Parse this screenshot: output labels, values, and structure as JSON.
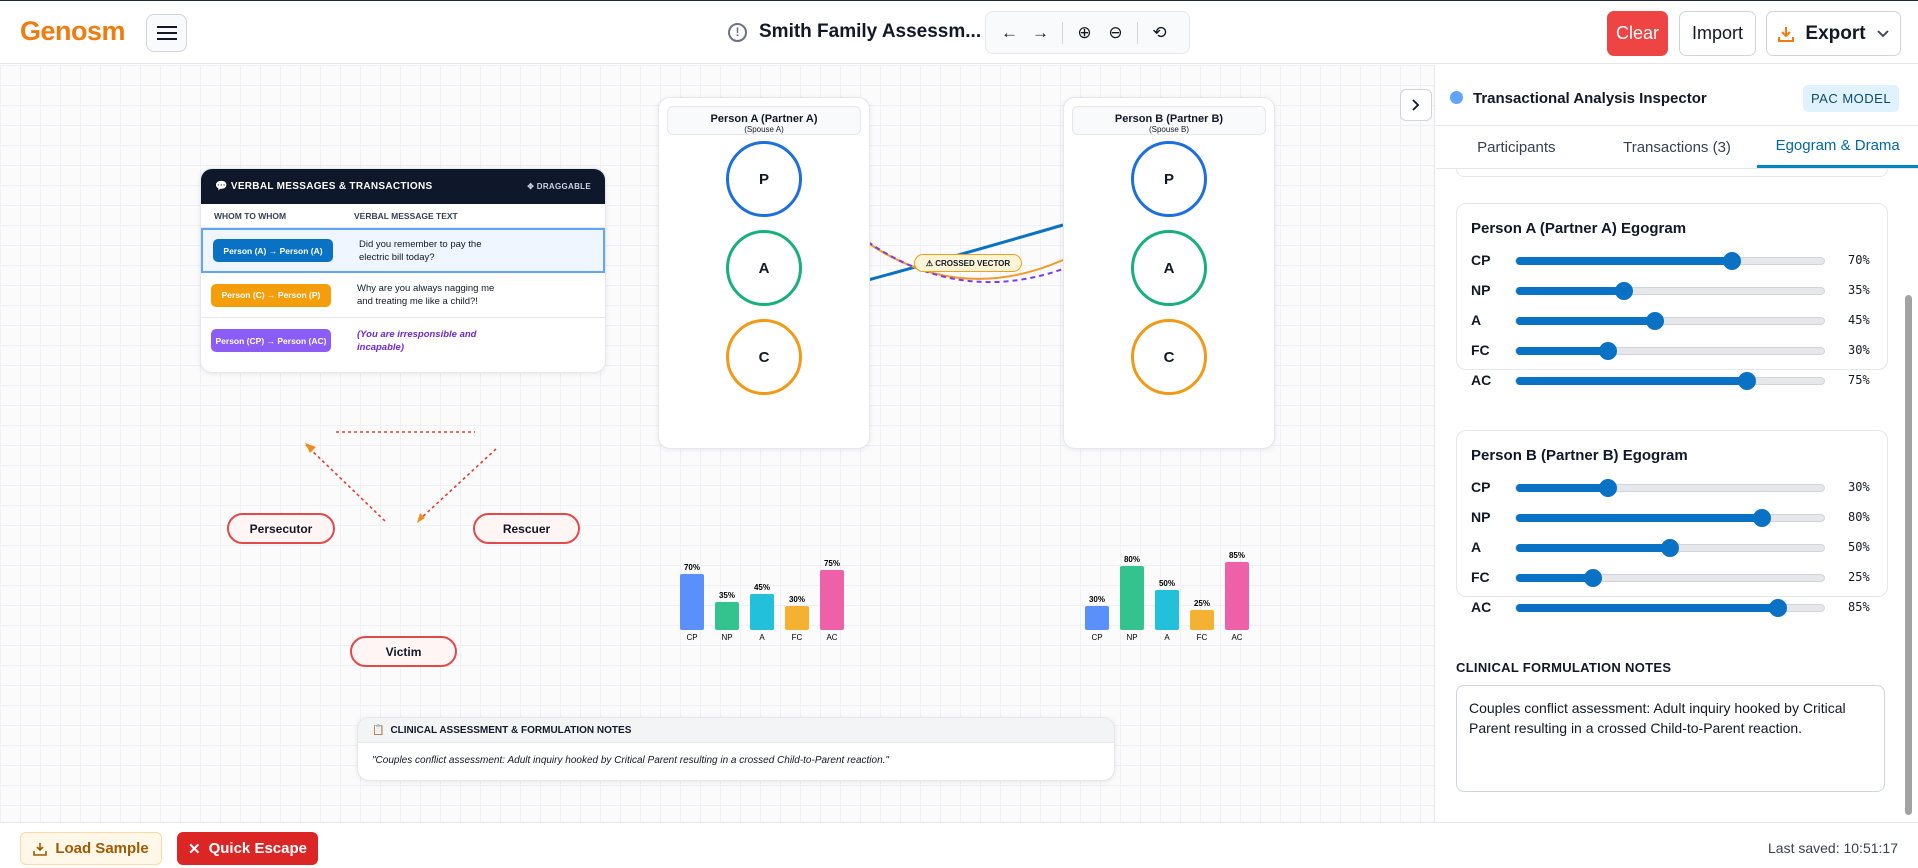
{
  "app": {
    "logo": "Genosm",
    "title": "Smith Family Assessm...",
    "info_glyph": "!"
  },
  "toolbar": {
    "undo": "←",
    "redo": "→",
    "zoom_in": "⊕",
    "zoom_out": "⊖",
    "reset": "⟲"
  },
  "actions": {
    "clear": "Clear",
    "import": "Import",
    "export": "Export"
  },
  "messages": {
    "header": "VERBAL MESSAGES & TRANSACTIONS",
    "draggable": "✥ DRAGGABLE",
    "col_whom": "WHOM TO WHOM",
    "col_text": "VERBAL MESSAGE TEXT",
    "rows": [
      {
        "route": "Person (A) → Person (A)",
        "text": "Did you remember to pay the electric bill today?",
        "color": "#0a72c4"
      },
      {
        "route": "Person (C) → Person (P)",
        "text": "Why are you always nagging me and treating me like a child?!",
        "color": "#f59e0b"
      },
      {
        "route": "Person (CP) → Person (AC)",
        "text": "(You are irresponsible and incapable)",
        "color": "#8b5cf6"
      }
    ]
  },
  "personA": {
    "name": "Person A (Partner A)",
    "sub": "(Spouse A)"
  },
  "personB": {
    "name": "Person B (Partner B)",
    "sub": "(Spouse B)"
  },
  "ego_states": {
    "p": "P",
    "a": "A",
    "c": "C"
  },
  "vector_badge": "⚠ CROSSED VECTOR",
  "drama": {
    "persecutor": "Persecutor",
    "rescuer": "Rescuer",
    "victim": "Victim"
  },
  "notes_canvas": {
    "header": "CLINICAL ASSESSMENT & FORMULATION NOTES",
    "text": "\"Couples conflict assessment: Adult inquiry hooked by Critical Parent resulting in a crossed Child-to-Parent reaction.\""
  },
  "panel": {
    "title": "Transactional Analysis Inspector",
    "badge": "PAC MODEL",
    "tabs": [
      "Participants",
      "Transactions (3)",
      "Egogram & Drama"
    ],
    "egoA_title": "Person A (Partner A) Egogram",
    "egoB_title": "Person B (Partner B) Egogram",
    "notes_label": "CLINICAL FORMULATION NOTES",
    "notes_text": "Couples conflict assessment: Adult inquiry hooked by Critical Parent resulting in a crossed Child-to-Parent reaction."
  },
  "chart_data": [
    {
      "type": "bar",
      "categories": [
        "CP",
        "NP",
        "A",
        "FC",
        "AC"
      ],
      "values": [
        70,
        35,
        45,
        30,
        75
      ],
      "value_labels": [
        "70%",
        "35%",
        "45%",
        "30%",
        "75%"
      ],
      "colors": [
        "#5b8ff9",
        "#34c38f",
        "#22c0da",
        "#f5b132",
        "#ee60a8"
      ]
    },
    {
      "type": "bar",
      "categories": [
        "CP",
        "NP",
        "A",
        "FC",
        "AC"
      ],
      "values": [
        30,
        80,
        50,
        25,
        85
      ],
      "value_labels": [
        "30%",
        "80%",
        "50%",
        "25%",
        "85%"
      ],
      "colors": [
        "#5b8ff9",
        "#34c38f",
        "#22c0da",
        "#f5b132",
        "#ee60a8"
      ]
    }
  ],
  "footer": {
    "load": "Load Sample",
    "escape": "Quick Escape",
    "saved": "Last saved: 10:51:17"
  }
}
